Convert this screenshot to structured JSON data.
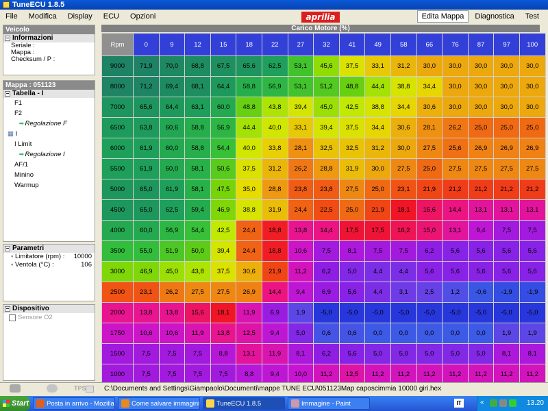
{
  "window": {
    "title": "TuneECU 1.8.5"
  },
  "menu": [
    "File",
    "Modifica",
    "Display",
    "ECU",
    "Opzioni"
  ],
  "logo_text": "aprilia",
  "tabs": [
    {
      "label": "Edita Mappa",
      "active": true
    },
    {
      "label": "Diagnostica",
      "active": false
    },
    {
      "label": "Test",
      "active": false
    }
  ],
  "veicolo": {
    "title": "Veicolo",
    "section": "Informazioni",
    "lines": [
      "Seriale :",
      "Mappa :",
      "Checksum / P :"
    ]
  },
  "mappa": {
    "title": "Mappa : 051123",
    "section": "Tabella - I",
    "items": [
      {
        "label": "F1",
        "sub": false
      },
      {
        "label": "F2",
        "sub": false
      },
      {
        "label": "Regolazione F",
        "sub": true
      },
      {
        "label": "I",
        "sub": false,
        "icon": "grid-icon"
      },
      {
        "label": "I Limit",
        "sub": false
      },
      {
        "label": "Regolazione I",
        "sub": true
      },
      {
        "label": "AF/1",
        "sub": false
      },
      {
        "label": "Minino",
        "sub": false
      },
      {
        "label": "Warmup",
        "sub": false
      }
    ]
  },
  "parametri": {
    "section": "Parametri",
    "rows": [
      {
        "label": "Limitatore (rpm) :",
        "value": "10000"
      },
      {
        "label": "Ventola (°C) :",
        "value": "106"
      }
    ]
  },
  "dispositivo": {
    "section": "Dispositivo",
    "checkbox": "Sensore O2"
  },
  "table": {
    "header": "Carico Motore (%)",
    "corner": "Rpm",
    "columns": [
      "0",
      "9",
      "12",
      "15",
      "18",
      "22",
      "27",
      "32",
      "41",
      "49",
      "58",
      "66",
      "76",
      "87",
      "97",
      "100"
    ],
    "rows": [
      {
        "rpm": "9000",
        "values": [
          "71,9",
          "70,0",
          "68,8",
          "67,5",
          "65,6",
          "62,5",
          "53,1",
          "45,6",
          "37,5",
          "33,1",
          "31,2",
          "30,0",
          "30,0",
          "30,0",
          "30,0",
          "30,0"
        ]
      },
      {
        "rpm": "8000",
        "values": [
          "71,2",
          "69,4",
          "68,1",
          "64,4",
          "58,8",
          "56,9",
          "53,1",
          "51,2",
          "48,8",
          "44,4",
          "38,8",
          "34,4",
          "30,0",
          "30,0",
          "30,0",
          "30,0"
        ]
      },
      {
        "rpm": "7000",
        "values": [
          "65,6",
          "64,4",
          "63,1",
          "60,0",
          "48,8",
          "43,8",
          "39,4",
          "45,0",
          "42,5",
          "38,8",
          "34,4",
          "30,6",
          "30,0",
          "30,0",
          "30,0",
          "30,0"
        ]
      },
      {
        "rpm": "6500",
        "values": [
          "63,8",
          "60,6",
          "58,8",
          "56,9",
          "44,4",
          "40,0",
          "33,1",
          "39,4",
          "37,5",
          "34,4",
          "30,6",
          "28,1",
          "26,2",
          "25,0",
          "25,0",
          "25,0"
        ]
      },
      {
        "rpm": "6000",
        "values": [
          "61,9",
          "60,0",
          "58,8",
          "54,4",
          "40,0",
          "33,8",
          "28,1",
          "32,5",
          "32,5",
          "31,2",
          "30,0",
          "27,5",
          "25,6",
          "26,9",
          "26,9",
          "26,9"
        ]
      },
      {
        "rpm": "5500",
        "values": [
          "61,9",
          "60,0",
          "58,1",
          "50,6",
          "37,5",
          "31,2",
          "26,2",
          "28,8",
          "31,9",
          "30,0",
          "27,5",
          "25,0",
          "27,5",
          "27,5",
          "27,5",
          "27,5"
        ]
      },
      {
        "rpm": "5000",
        "values": [
          "65,0",
          "61,9",
          "58,1",
          "47,5",
          "35,0",
          "28,8",
          "23,8",
          "23,8",
          "27,5",
          "25,0",
          "23,1",
          "21,9",
          "21,2",
          "21,2",
          "21,2",
          "21,2"
        ]
      },
      {
        "rpm": "4500",
        "values": [
          "65,0",
          "62,5",
          "59,4",
          "46,9",
          "38,8",
          "31,9",
          "24,4",
          "22,5",
          "25,0",
          "21,9",
          "18,1",
          "15,6",
          "14,4",
          "13,1",
          "13,1",
          "13,1"
        ]
      },
      {
        "rpm": "4000",
        "values": [
          "60,0",
          "56,9",
          "54,4",
          "42,5",
          "24,4",
          "18,8",
          "13,8",
          "14,4",
          "17,5",
          "17,5",
          "16,2",
          "15,0",
          "13,1",
          "9,4",
          "7,5",
          "7,5"
        ]
      },
      {
        "rpm": "3500",
        "values": [
          "55,0",
          "51,9",
          "50,0",
          "39,4",
          "24,4",
          "18,8",
          "10,6",
          "7,5",
          "8,1",
          "7,5",
          "7,5",
          "6,2",
          "5,6",
          "5,6",
          "5,6",
          "5,6"
        ]
      },
      {
        "rpm": "3000",
        "values": [
          "46,9",
          "45,0",
          "43,8",
          "37,5",
          "30,6",
          "21,9",
          "11,2",
          "6,2",
          "5,0",
          "4,4",
          "4,4",
          "5,6",
          "5,6",
          "5,6",
          "5,6",
          "5,6"
        ]
      },
      {
        "rpm": "2500",
        "values": [
          "23,1",
          "26,2",
          "27,5",
          "27,5",
          "26,9",
          "14,4",
          "9,4",
          "6,9",
          "5,6",
          "4,4",
          "3,1",
          "2,5",
          "1,2",
          "-0,6",
          "-1,9",
          "-1,9"
        ]
      },
      {
        "rpm": "2000",
        "values": [
          "13,8",
          "13,8",
          "15,6",
          "18,1",
          "11,9",
          "6,9",
          "1,9",
          "-5,0",
          "-5,0",
          "-5,0",
          "-5,0",
          "-5,0",
          "-5,0",
          "-5,0",
          "-5,0",
          "-5,0"
        ]
      },
      {
        "rpm": "1750",
        "values": [
          "10,6",
          "10,6",
          "11,9",
          "13,8",
          "12,5",
          "9,4",
          "5,0",
          "0,6",
          "0,6",
          "0,0",
          "0,0",
          "0,0",
          "0,0",
          "0,0",
          "1,9",
          "1,9"
        ]
      },
      {
        "rpm": "1500",
        "values": [
          "7,5",
          "7,5",
          "7,5",
          "8,8",
          "13,1",
          "11,9",
          "8,1",
          "6,2",
          "5,6",
          "5,0",
          "5,0",
          "5,0",
          "5,0",
          "5,0",
          "8,1",
          "8,1"
        ]
      },
      {
        "rpm": "1000",
        "values": [
          "7,5",
          "7,5",
          "7,5",
          "7,5",
          "8,8",
          "9,4",
          "10,0",
          "11,2",
          "12,5",
          "11,2",
          "11,2",
          "11,2",
          "11,2",
          "11,2",
          "11,2",
          "11,2"
        ]
      }
    ]
  },
  "statusbar": {
    "tps_label": "TPS",
    "path": "C:\\Documents and Settings\\Giampaolo\\Documenti\\mappe TUNE ECU\\051123Map  caposcimmia 10000 giri.hex"
  },
  "taskbar": {
    "start": "Start",
    "tasks": [
      {
        "label": "Posta in arrivo - Mozilla T...",
        "active": false,
        "color": "#e06020"
      },
      {
        "label": "Come salvare immagini d...",
        "active": false,
        "color": "#e88a20"
      },
      {
        "label": "TuneECU 1.8.5",
        "active": true,
        "color": "#ffd64a"
      },
      {
        "label": "Immagine - Paint",
        "active": false,
        "color": "#c9a"
      }
    ],
    "lang": "IT",
    "time": "13.20"
  },
  "colors": {
    "column_header": "#3340d8",
    "rpm_header_high": "#1f8a6a"
  }
}
